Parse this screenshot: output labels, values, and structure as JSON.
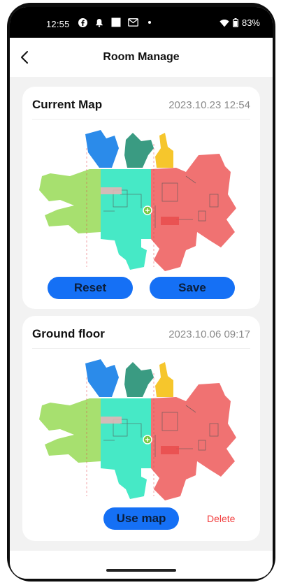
{
  "status_bar": {
    "time": "12:55",
    "battery": "83%",
    "icons": [
      "facebook-icon",
      "notification-bell-icon",
      "square-icon",
      "gmail-icon",
      "dot-icon",
      "wifi-icon",
      "battery-icon"
    ]
  },
  "header": {
    "title": "Room Manage",
    "back_icon": "chevron-left-icon"
  },
  "current_map": {
    "title": "Current Map",
    "date": "2023.10.23 12:54",
    "reset_label": "Reset",
    "save_label": "Save"
  },
  "ground_floor": {
    "title": "Ground floor",
    "date": "2023.10.06 09:17",
    "use_map_label": "Use map",
    "delete_label": "Delete"
  },
  "colors": {
    "accent": "#1570f5",
    "delete": "#f24040",
    "room_green": "#a7e06f",
    "room_teal": "#46e9c6",
    "room_red": "#f07272",
    "room_blue": "#2b8bea",
    "room_darkgreen": "#3a9b82",
    "room_yellow": "#f6c62c"
  }
}
